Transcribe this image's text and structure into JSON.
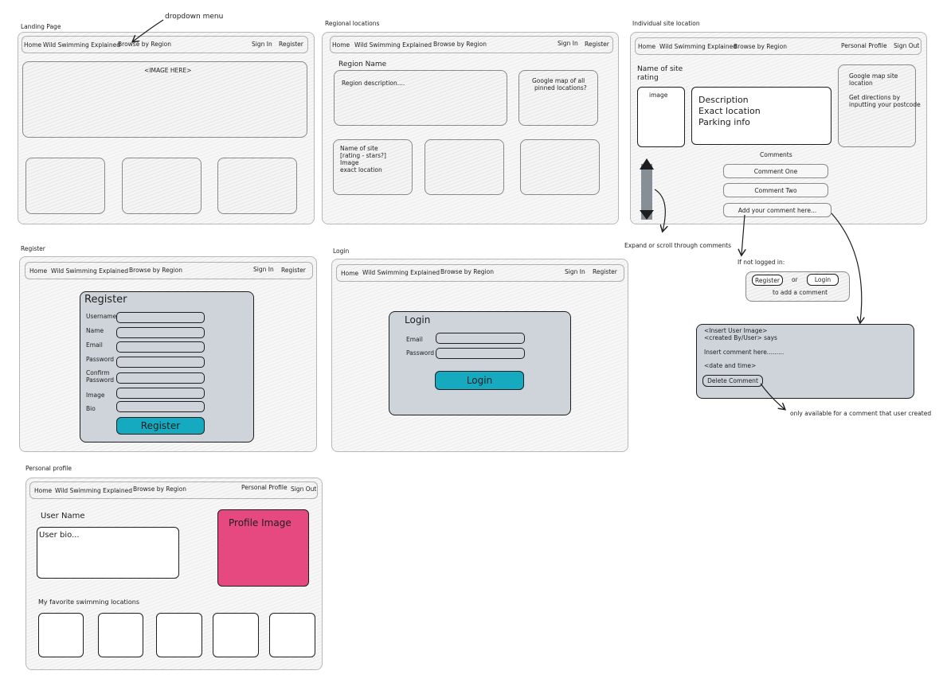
{
  "annotations": {
    "dropdown_menu": "dropdown menu",
    "expand_scroll": "Expand or scroll through comments",
    "if_not_logged_in": "If not logged in:",
    "only_available": "only available for a comment that user created"
  },
  "landing": {
    "label": "Landing Page",
    "nav": {
      "home": "Home",
      "wild": "Wild Swimming Explained",
      "browse": "Browse by Region",
      "signin": "Sign In",
      "register": "Register"
    },
    "image_placeholder": "<IMAGE HERE>"
  },
  "regional": {
    "label": "Regional locations",
    "nav": {
      "home": "Home",
      "wild": "Wild Swimming Explained",
      "browse": "Browse by Region",
      "signin": "Sign In",
      "register": "Register"
    },
    "region_name": "Region Name",
    "region_description": "Region description....",
    "map_text": [
      "Google map of all",
      "pinned locations?"
    ],
    "card_lines": [
      "Name of site",
      "[rating - stars?]",
      "Image",
      "exact location"
    ]
  },
  "individual": {
    "label": "Individual site location",
    "nav": {
      "home": "Home",
      "wild": "Wild Swimming Explained",
      "browse": "Browse by Region",
      "profile": "Personal Profile",
      "signout": "Sign Out"
    },
    "name_of_site": "Name of site",
    "rating": "rating",
    "image": "image",
    "desc_lines": [
      "Description",
      "Exact location",
      "Parking info"
    ],
    "map_lines": [
      "Google map site",
      "location"
    ],
    "dir_lines": [
      "Get directions by",
      "inputting your postcode"
    ],
    "comments_title": "Comments",
    "comment_one": "Comment One",
    "comment_two": "Comment Two",
    "add_comment": "Add your comment here...",
    "logged_out": {
      "register": "Register",
      "or": "or",
      "login": "Login",
      "to_add": "to add a comment"
    },
    "comment_detail": {
      "line1": "<Insert User Image>",
      "line2": "<created By/User> says",
      "line3": "Insert comment here.........",
      "line4": "<date and time>",
      "delete": "Delete Comment"
    }
  },
  "register_page": {
    "label": "Register",
    "nav": {
      "home": "Home",
      "wild": "Wild Swimming Explained",
      "browse": "Browse by Region",
      "signin": "Sign In",
      "register": "Register"
    },
    "title": "Register",
    "fields": [
      "Username",
      "Name",
      "Email",
      "Password",
      "Confirm",
      "Password",
      "Image",
      "Bio"
    ],
    "button": "Register"
  },
  "login_page": {
    "label": "Login",
    "nav": {
      "home": "Home",
      "wild": "Wild Swimming Explained",
      "browse": "Browse by Region",
      "signin": "Sign In",
      "register": "Register"
    },
    "title": "Login",
    "fields": [
      "Email",
      "Password"
    ],
    "button": "Login"
  },
  "profile_page": {
    "label": "Personal profile",
    "nav": {
      "home": "Home",
      "wild": "Wild Swimming Explained",
      "browse": "Browse by Region",
      "profile": "Personal Profile",
      "signout": "Sign Out"
    },
    "user_name": "User Name",
    "user_bio": "User bio...",
    "profile_image": "Profile Image",
    "favorites_title": "My favorite swimming locations",
    "profile_color": "#e64980"
  }
}
